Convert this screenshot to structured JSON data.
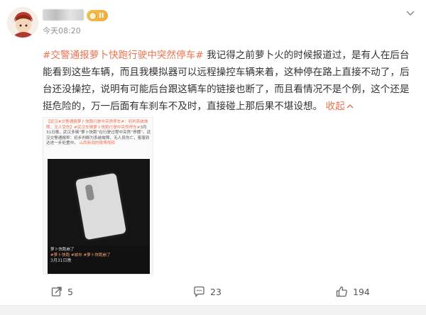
{
  "post": {
    "user": {
      "level_badge": "II"
    },
    "timestamp": "今天08:20",
    "text": {
      "hashtag": "#交警通报萝卜快跑行驶中突然停车#",
      "body": " 我记得之前萝卜火的时候报道过，是有人在后台能看到这些车辆，而且我模拟器可以远程操控车辆来着，这种停在路上直接不动了，后台还没操控，说明有可能后台跟这辆车的链接也断了，而且看情况不是个例，这个还是挺危险的，万一后面有车刹车不及时，直接碰上那后果不堪设想。",
      "collapse_label": "收起"
    },
    "media": {
      "top_text_tag": "【武汉#交警通报萝卜快跑行驶中突然停车#：初判系统故障，无人受伤】",
      "top_text_tag2": "#武汉车辆萝卜快跑行驶中突然停车#",
      "top_text_body": "3月31日晚，武汉多辆“萝卜快跑”在行驶过程中突然“停摆”。武汉交警通报称：初步判断为系统故障，无人员伤亡，客服到达进一步处置中。",
      "top_text_link": "山西新闻的微博视频",
      "caption_line1": "萝卜快跑崩了",
      "caption_tags": "#萝卜快跑 #城市 #萝卜快跑崩了",
      "caption_line3": "3月31日晚"
    },
    "actions": {
      "share_count": "5",
      "comment_count": "23",
      "like_count": "194"
    }
  },
  "colors": {
    "accent": "#eb7350",
    "text": "#333333",
    "muted": "#939393"
  },
  "icons": [
    "avatar",
    "level-badge-icon",
    "more-chevron-icon",
    "share-icon",
    "comment-icon",
    "like-icon",
    "collapse-chevron-icon"
  ]
}
